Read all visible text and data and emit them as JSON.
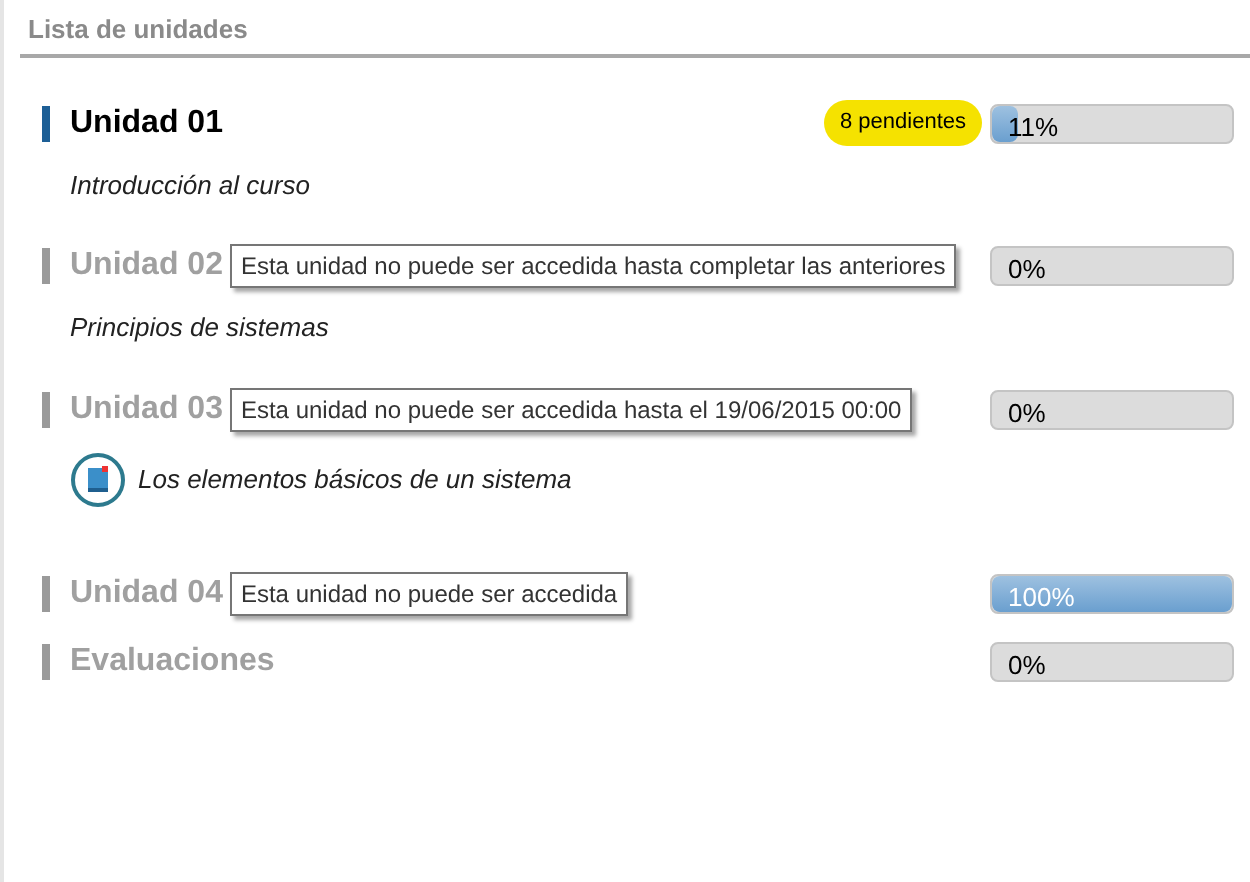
{
  "header": {
    "title": "Lista de unidades"
  },
  "units": [
    {
      "title": "Unidad 01",
      "locked": false,
      "badge": "8 pendientes",
      "level": 0.11,
      "reading": "11%",
      "items": [
        {
          "kind": "text",
          "label": "Introducción al curso"
        }
      ]
    },
    {
      "title": "Unidad 02",
      "locked": true,
      "tooltip": "Esta unidad no puede ser accedida hasta completar las anteriores",
      "level": 0,
      "reading": "0%",
      "items": [
        {
          "kind": "text",
          "label": "Principios de sistemas"
        }
      ]
    },
    {
      "title": "Unidad 03",
      "locked": true,
      "tooltip": "Esta unidad no puede ser accedida hasta el 19/06/2015 00:00",
      "level": 0,
      "reading": "0%",
      "items": [
        {
          "kind": "lesson",
          "label": "Los elementos básicos de un sistema"
        }
      ]
    },
    {
      "title": "Unidad 04",
      "locked": true,
      "tooltip": "Esta unidad no puede ser accedida",
      "level": 1,
      "reading": "100%"
    },
    {
      "title": "Evaluaciones",
      "locked": true,
      "level": 0,
      "reading": "0%"
    }
  ]
}
